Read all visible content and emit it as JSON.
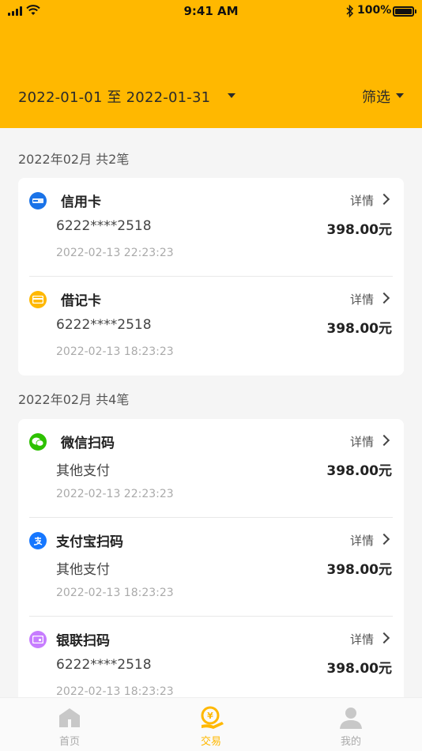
{
  "status_bar": {
    "time": "9:41 AM",
    "battery": "100%"
  },
  "header": {
    "date_range": "2022-01-01 至 2022-01-31",
    "filter_label": "筛选"
  },
  "groups": [
    {
      "title": "2022年02月 共2笔",
      "items": [
        {
          "name": "信用卡",
          "detail": "详情",
          "sub": "6222****2518",
          "amount": "398.00元",
          "time": "2022-02-13 22:23:23",
          "icon": "unionpay-icon",
          "icon_color": "#1a73e8"
        },
        {
          "name": "借记卡",
          "detail": "详情",
          "sub": "6222****2518",
          "amount": "398.00元",
          "time": "2022-02-13 18:23:23",
          "icon": "card-icon",
          "icon_color": "#ffb800"
        }
      ]
    },
    {
      "title": "2022年02月 共4笔",
      "items": [
        {
          "name": "微信扫码",
          "detail": "详情",
          "sub": "其他支付",
          "amount": "398.00元",
          "time": "2022-02-13 22:23:23",
          "icon": "wechat-icon",
          "icon_color": "#2dc100"
        },
        {
          "name": "支付宝扫码",
          "detail": "详情",
          "sub": "其他支付",
          "amount": "398.00元",
          "time": "2022-02-13 18:23:23",
          "icon": "alipay-icon",
          "icon_color": "#1677ff"
        },
        {
          "name": "银联扫码",
          "detail": "详情",
          "sub": "6222****2518",
          "amount": "398.00元",
          "time": "2022-02-13 18:23:23",
          "icon": "unionpay-qr-icon",
          "icon_color": "#c77dff"
        }
      ]
    }
  ],
  "tabbar": {
    "tabs": [
      {
        "label": "首页",
        "icon": "home-icon"
      },
      {
        "label": "交易",
        "icon": "transaction-icon"
      },
      {
        "label": "我的",
        "icon": "user-icon"
      }
    ],
    "active_color": "#ffb800",
    "inactive_color": "#aaaaaa"
  }
}
